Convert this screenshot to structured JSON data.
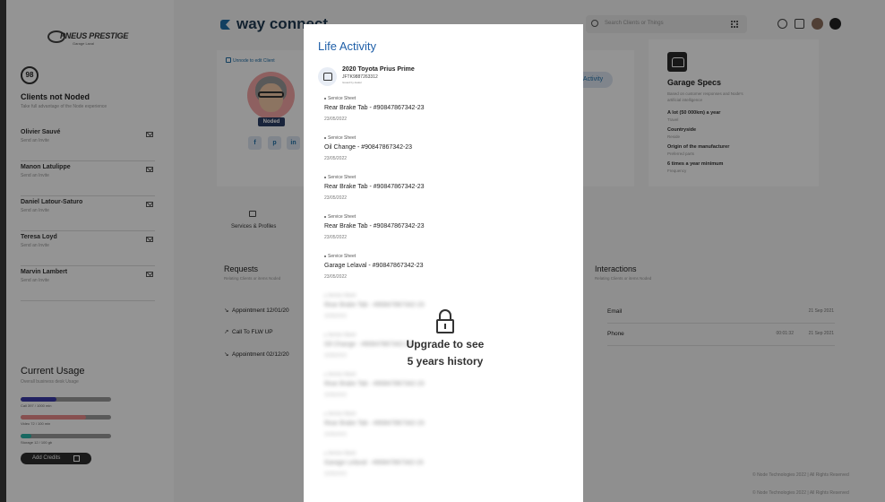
{
  "brand": {
    "logo_text": "PNEUS PRESTIGE",
    "logo_sub": "Garage  Laval",
    "app_name": "way connect"
  },
  "search": {
    "placeholder": "Search Clients or Things"
  },
  "sidebar": {
    "count": "98",
    "title": "Clients not Noded",
    "subtitle": "Take full advantage of the Node experience",
    "clients": [
      {
        "name": "Olivier Sauvé",
        "action": "Send an Invite"
      },
      {
        "name": "Manon Latulippe",
        "action": "Send an Invite"
      },
      {
        "name": "Daniel Latour-Saturo",
        "action": "Send an Invite"
      },
      {
        "name": "Teresa Loyd",
        "action": "Send an Invite"
      },
      {
        "name": "Marvin Lambert",
        "action": "Send an Invite"
      }
    ]
  },
  "usage": {
    "title": "Current Usage",
    "subtitle": "Overall business desk Usage",
    "bars": [
      {
        "label": "Call 397 / 1000 min",
        "fraction": 0.397,
        "color": "#3a3aa8"
      },
      {
        "label": "Video 72 / 100 min",
        "fraction": 0.72,
        "color": "#e88a8a"
      },
      {
        "label": "Storage 12 / 100 gb",
        "fraction": 0.12,
        "color": "#2ab3a8"
      }
    ],
    "add_credits_label": "Add Credits"
  },
  "profile": {
    "unnode_label": "Unnode to edit Client",
    "noded_badge": "Noded",
    "socials": [
      "f",
      "p",
      "in"
    ],
    "activity_pill": "Activity",
    "tab_label": "Services & Profiles"
  },
  "garage_specs": {
    "title": "Garage Specs",
    "subtitle": "Based on customer responses and Node's artificial intelligence",
    "items": [
      {
        "value": "A lot (50 000km) a year",
        "label": "Travel"
      },
      {
        "value": "Countryside",
        "label": "Reside"
      },
      {
        "value": "Origin of the manufacturer",
        "label": "Preferred parts"
      },
      {
        "value": "6 times a year minimum",
        "label": "Frequency"
      }
    ]
  },
  "requests": {
    "title": "Requests",
    "subtitle": "Relating Clients or items Noded",
    "rows": [
      {
        "arrow": "↘",
        "text": "Appointment 12/01/20"
      },
      {
        "arrow": "↗",
        "text": "Call To FLW UP"
      },
      {
        "arrow": "↘",
        "text": "Appointment 02/12/20"
      }
    ]
  },
  "interactions": {
    "title": "Interactions",
    "subtitle": "Relating Clients or items Noded",
    "rows": [
      {
        "label": "Email",
        "duration": "",
        "date": "21 Sep 2021"
      },
      {
        "label": "Phone",
        "duration": "00:01:32",
        "date": "21 Sep 2021"
      }
    ]
  },
  "footer": {
    "text": "© Node Technologies 2022 | All Rights Reserved"
  },
  "modal": {
    "title": "Life Activity",
    "car": {
      "name": "2020 Toyota Prius Prime",
      "vin": "JFTK9887263312",
      "tiny": "Issued by dealer"
    },
    "entries": [
      {
        "tag": "Service Sheet",
        "title": "Rear Brake Tab - #90847867342-23",
        "date": "23/05/2022"
      },
      {
        "tag": "Service Sheet",
        "title": "Oil Change - #90847867342-23",
        "date": "23/05/2022"
      },
      {
        "tag": "Service Sheet",
        "title": "Rear Brake Tab - #90847867342-23",
        "date": "23/05/2022"
      },
      {
        "tag": "Service Sheet",
        "title": "Rear Brake Tab - #90847867342-23",
        "date": "23/05/2022"
      },
      {
        "tag": "Service Sheet",
        "title": "Garage Lelaval - #90847867342-23",
        "date": "23/05/2022"
      }
    ],
    "blurred_entries": [
      {
        "tag": "Service Sheet",
        "title": "Rear Brake Tab - #90847867342-23",
        "date": "23/05/2022"
      },
      {
        "tag": "Service Sheet",
        "title": "Oil Change - #90847867342-23",
        "date": "23/05/2022"
      },
      {
        "tag": "Service Sheet",
        "title": "Rear Brake Tab - #90847867342-23",
        "date": "23/05/2022"
      },
      {
        "tag": "Service Sheet",
        "title": "Rear Brake Tab - #90847867342-23",
        "date": "23/05/2022"
      },
      {
        "tag": "Service Sheet",
        "title": "Garage Lelaval - #90847867342-23",
        "date": "23/05/2022"
      }
    ],
    "upgrade_line1": "Upgrade to see",
    "upgrade_line2": "5 years history"
  }
}
